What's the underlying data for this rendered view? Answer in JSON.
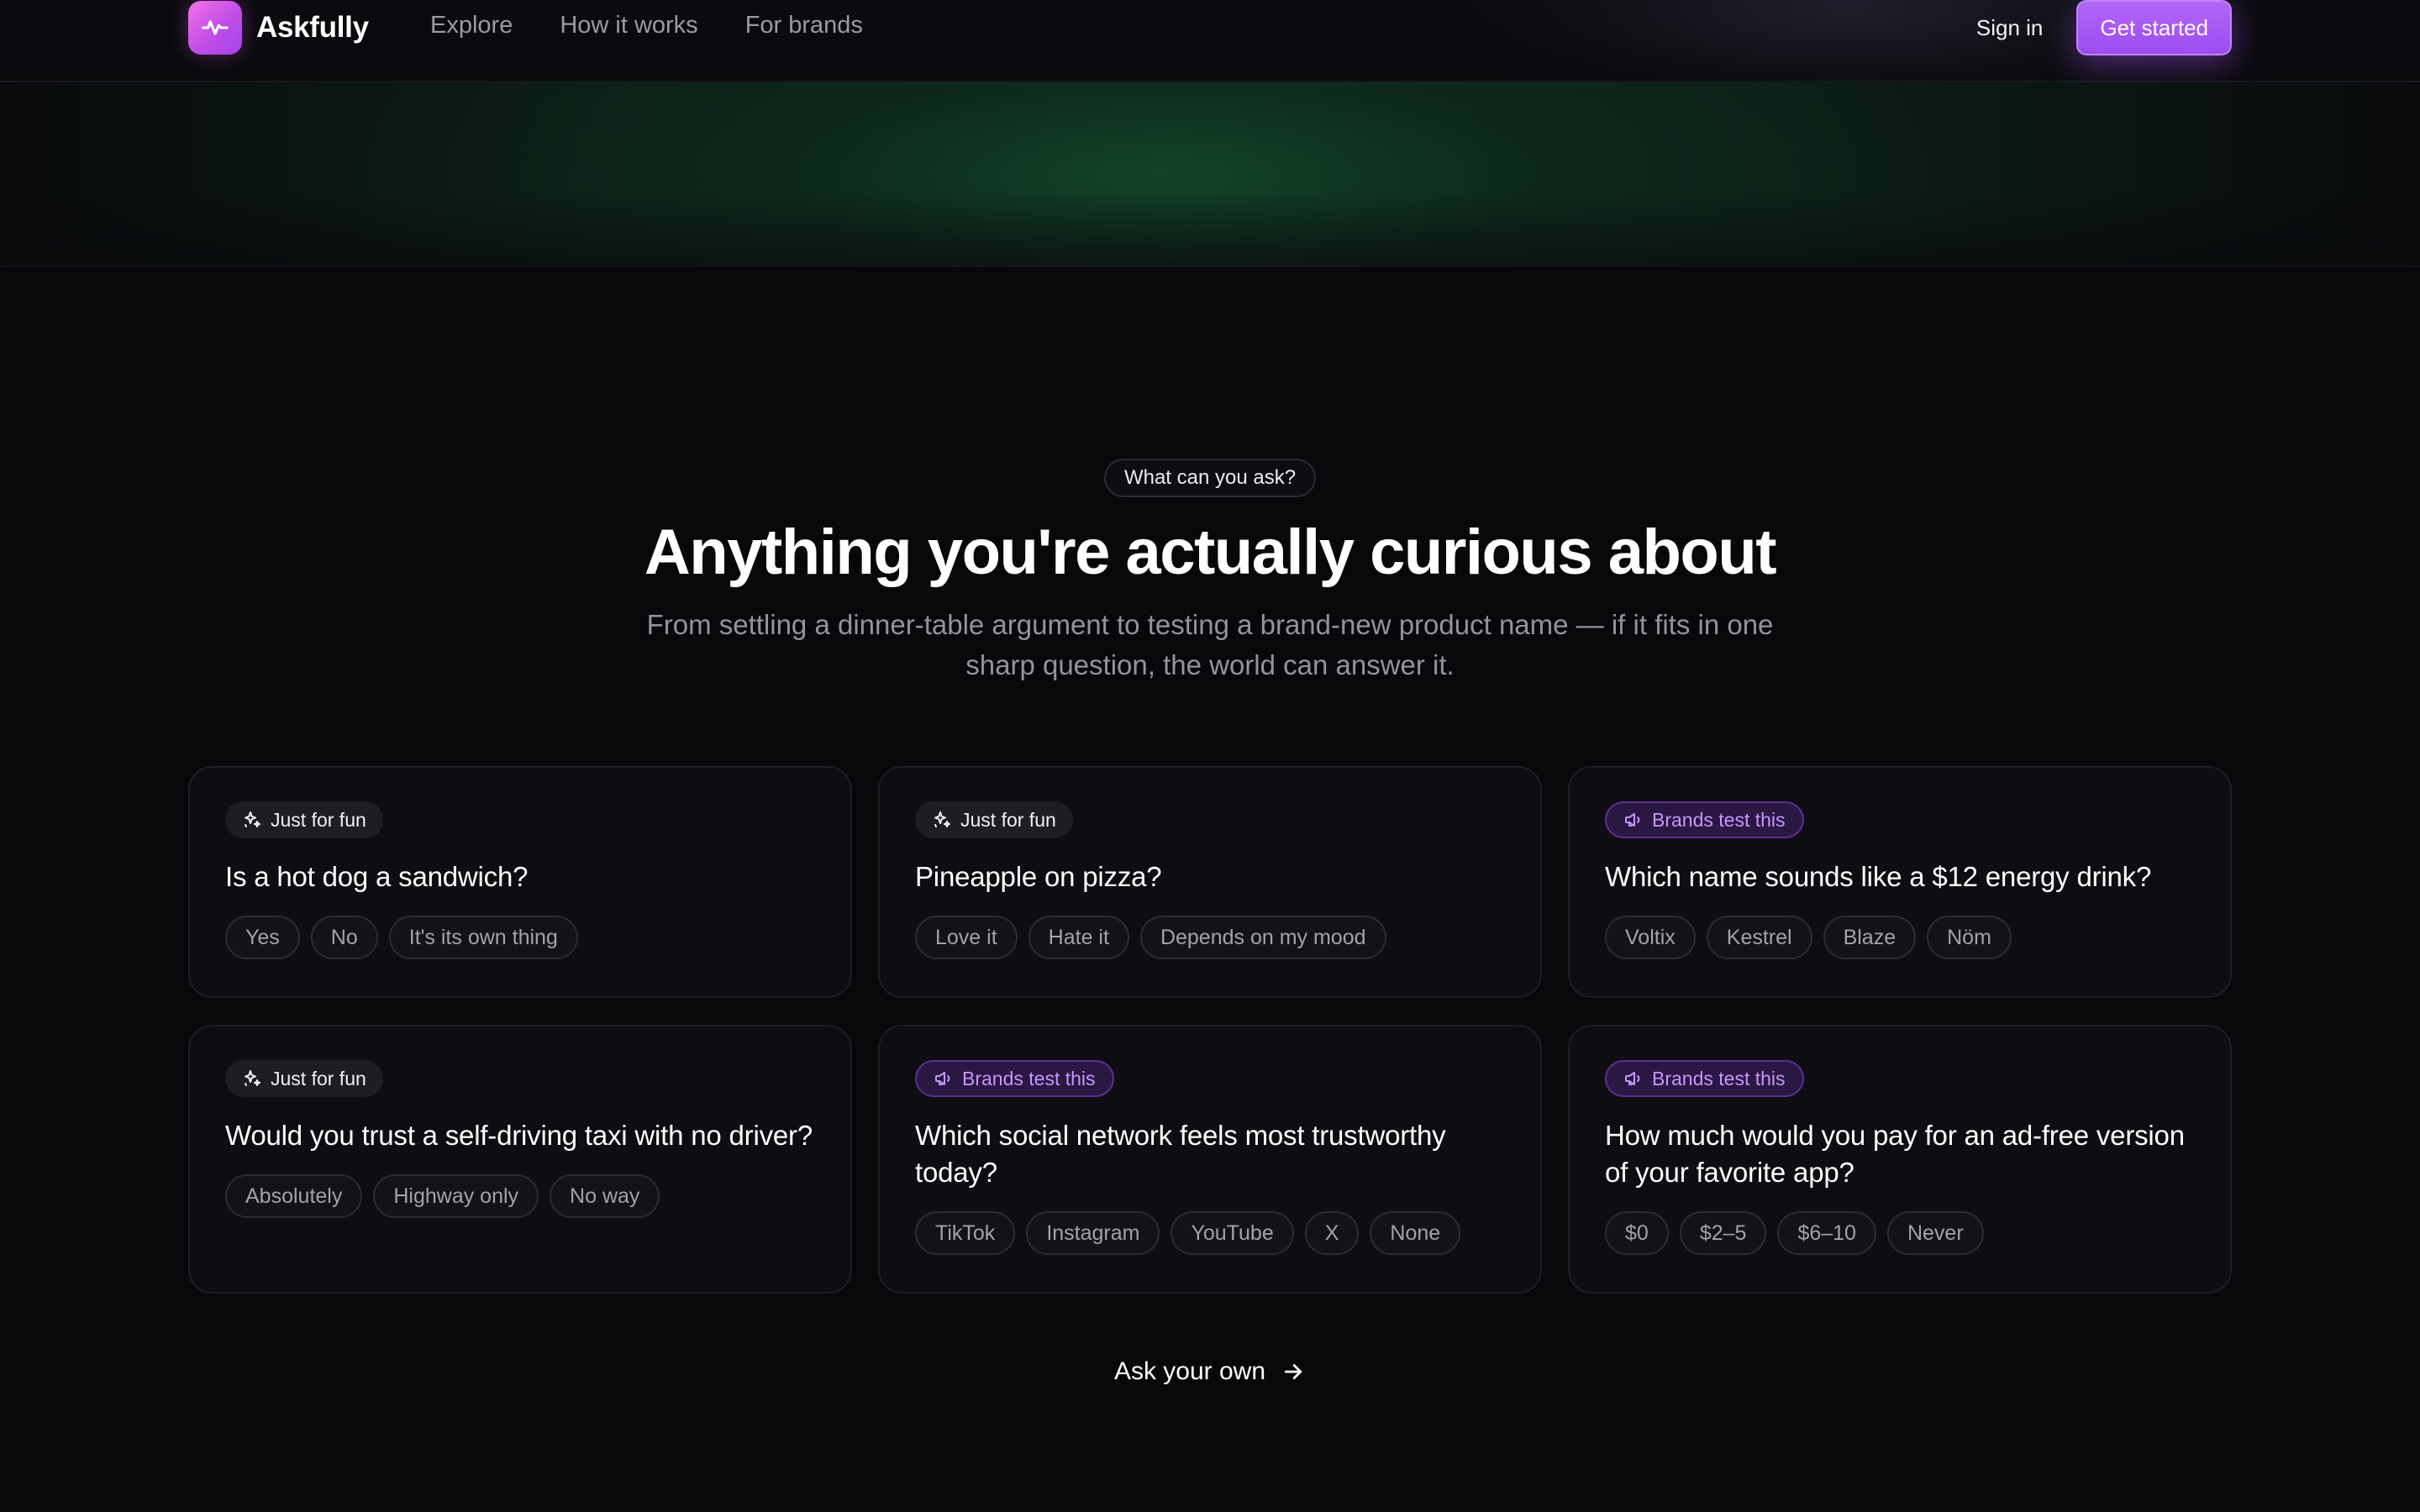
{
  "brand": {
    "name": "Askfully"
  },
  "nav": {
    "links": [
      "Explore",
      "How it works",
      "For brands"
    ],
    "sign_in": "Sign in",
    "get_started": "Get started"
  },
  "section": {
    "eyebrow": "What can you ask?",
    "title": "Anything you're actually curious about",
    "subtitle": "From settling a dinner-table argument to testing a brand-new product name — if it fits in one sharp question, the world can answer it."
  },
  "cards": [
    {
      "tag": "Just for fun",
      "tag_type": "fun",
      "question": "Is a hot dog a sandwich?",
      "options": [
        "Yes",
        "No",
        "It's its own thing"
      ]
    },
    {
      "tag": "Just for fun",
      "tag_type": "fun",
      "question": "Pineapple on pizza?",
      "options": [
        "Love it",
        "Hate it",
        "Depends on my mood"
      ]
    },
    {
      "tag": "Brands test this",
      "tag_type": "brand",
      "question": "Which name sounds like a $12 energy drink?",
      "options": [
        "Voltix",
        "Kestrel",
        "Blaze",
        "Nöm"
      ]
    },
    {
      "tag": "Just for fun",
      "tag_type": "fun",
      "question": "Would you trust a self-driving taxi with no driver?",
      "options": [
        "Absolutely",
        "Highway only",
        "No way"
      ]
    },
    {
      "tag": "Brands test this",
      "tag_type": "brand",
      "question": "Which social network feels most trustworthy today?",
      "options": [
        "TikTok",
        "Instagram",
        "YouTube",
        "X",
        "None"
      ]
    },
    {
      "tag": "Brands test this",
      "tag_type": "brand",
      "question": "How much would you pay for an ad-free version of your favorite app?",
      "options": [
        "$0",
        "$2–5",
        "$6–10",
        "Never"
      ]
    }
  ],
  "cta": {
    "label": "Ask your own"
  },
  "colors": {
    "accent": "#a855f7",
    "brand_tag": "#c896ff",
    "background": "#08080b"
  },
  "icons": {
    "logo": "pulse-icon",
    "fun_tag": "sparkles-icon",
    "brand_tag": "megaphone-icon",
    "cta": "arrow-right-icon"
  }
}
